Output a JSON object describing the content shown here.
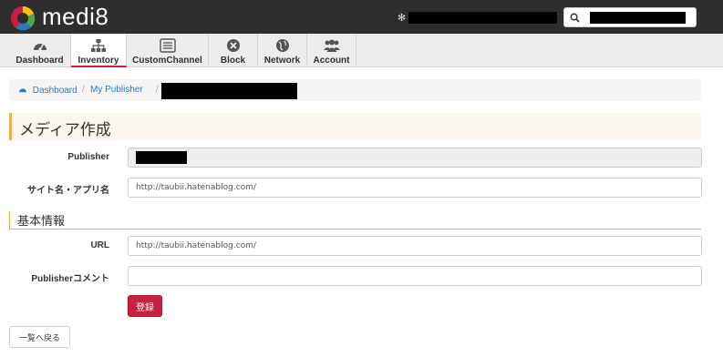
{
  "app": {
    "brand": "medi8"
  },
  "header": {
    "settings_icon": "gear-icon",
    "search_icon": "search-icon"
  },
  "nav": {
    "items": [
      {
        "label": "Dashboard",
        "icon": "dashboard-icon"
      },
      {
        "label": "Inventory",
        "icon": "sitemap-icon",
        "active": true
      },
      {
        "label": "CustomChannel",
        "icon": "list-icon"
      },
      {
        "label": "Block",
        "icon": "block-icon"
      },
      {
        "label": "Network",
        "icon": "globe-icon"
      },
      {
        "label": "Account",
        "icon": "users-icon"
      }
    ]
  },
  "breadcrumb": {
    "home": "Dashboard",
    "sep": "/",
    "level1": "My Publisher"
  },
  "form": {
    "title": "メディア作成",
    "publisher_label": "Publisher",
    "site_label": "サイト名・アプリ名",
    "site_value": "http://taubii.hatenablog.com/",
    "section_basic": "基本情報",
    "url_label": "URL",
    "url_value": "http://taubii.hatenablog.com/",
    "comment_label": "Publisherコメント",
    "comment_value": "",
    "submit_label": "登録",
    "back_label": "一覧へ戻る"
  },
  "colors": {
    "accent": "#c9203f",
    "section_border": "#f0ad4e",
    "topbar": "#2e2e2e"
  }
}
